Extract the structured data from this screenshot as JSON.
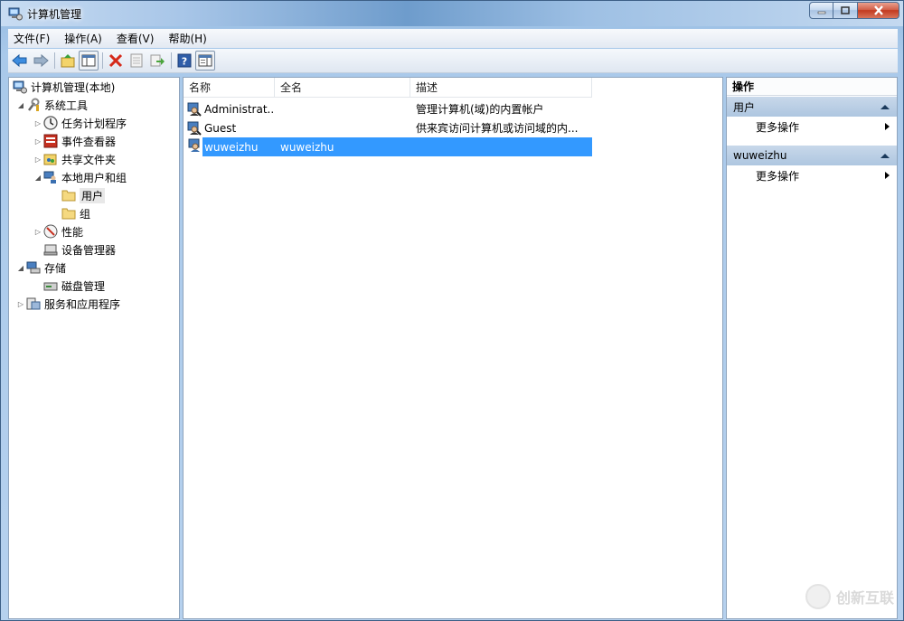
{
  "window": {
    "title": "计算机管理",
    "controls": {
      "minimize": "minimize",
      "maximize": "maximize",
      "close": "close"
    }
  },
  "menubar": {
    "items": [
      {
        "label": "文件(F)"
      },
      {
        "label": "操作(A)"
      },
      {
        "label": "查看(V)"
      },
      {
        "label": "帮助(H)"
      }
    ]
  },
  "toolbar": {
    "icons": [
      "back-arrow-icon",
      "forward-arrow-icon",
      "up-folder-icon",
      "show-hide-tree-icon",
      "delete-icon",
      "properties-icon",
      "export-list-icon",
      "help-icon",
      "action-pane-icon"
    ]
  },
  "tree": {
    "items": [
      {
        "label": "计算机管理(本地)",
        "icon": "computer-management-icon"
      },
      {
        "label": "系统工具",
        "icon": "system-tools-icon"
      },
      {
        "label": "任务计划程序",
        "icon": "task-scheduler-icon"
      },
      {
        "label": "事件查看器",
        "icon": "event-viewer-icon"
      },
      {
        "label": "共享文件夹",
        "icon": "shared-folders-icon"
      },
      {
        "label": "本地用户和组",
        "icon": "local-users-groups-icon"
      },
      {
        "label": "用户",
        "icon": "folder-icon"
      },
      {
        "label": "组",
        "icon": "folder-icon"
      },
      {
        "label": "性能",
        "icon": "performance-icon"
      },
      {
        "label": "设备管理器",
        "icon": "device-manager-icon"
      },
      {
        "label": "存储",
        "icon": "storage-icon"
      },
      {
        "label": "磁盘管理",
        "icon": "disk-management-icon"
      },
      {
        "label": "服务和应用程序",
        "icon": "services-applications-icon"
      }
    ]
  },
  "list": {
    "columns": [
      {
        "label": "名称"
      },
      {
        "label": "全名"
      },
      {
        "label": "描述"
      }
    ],
    "rows": [
      {
        "name": "Administrat...",
        "fullname": "",
        "description": "管理计算机(域)的内置帐户"
      },
      {
        "name": "Guest",
        "fullname": "",
        "description": "供来宾访问计算机或访问域的内..."
      },
      {
        "name": "wuweizhu",
        "fullname": "wuweizhu",
        "description": ""
      }
    ],
    "selected_index": 2
  },
  "actions": {
    "title": "操作",
    "sections": [
      {
        "label": "用户",
        "more": "更多操作"
      },
      {
        "label": "wuweizhu",
        "more": "更多操作"
      }
    ]
  },
  "watermark": {
    "text": "创新互联"
  },
  "colors": {
    "selection": "#3399ff",
    "section_header": "#b9cde4"
  }
}
